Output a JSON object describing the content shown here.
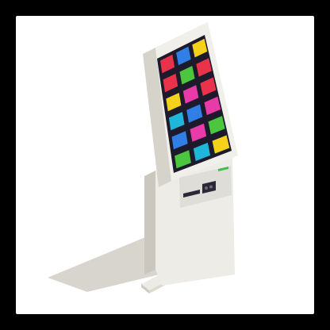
{
  "illustration": {
    "subject": "kiosk-touchscreen-icon",
    "colors": {
      "background": "#ffffff",
      "outer_frame": "#000000",
      "body_light": "#f1efe9",
      "body_mid": "#dedbd3",
      "body_shadow": "#cbc7be",
      "screen_dark": "#1d1a2b",
      "ground_shadow": "#d8d5ce",
      "accent_green": "#3fbf4c",
      "tile_red": "#e8334a",
      "tile_blue": "#2f7fe6",
      "tile_yellow": "#f4d21b",
      "tile_green": "#4cc63f",
      "tile_magenta": "#e83aa8",
      "tile_cyan": "#1fb6d9"
    },
    "app_tiles": [
      "tile_red",
      "tile_blue",
      "tile_yellow",
      "tile_red",
      "tile_green",
      "tile_red",
      "tile_yellow",
      "tile_magenta",
      "tile_red",
      "tile_cyan",
      "tile_blue",
      "tile_magenta",
      "tile_blue",
      "tile_magenta",
      "tile_green",
      "tile_green",
      "tile_cyan",
      "tile_yellow"
    ]
  }
}
